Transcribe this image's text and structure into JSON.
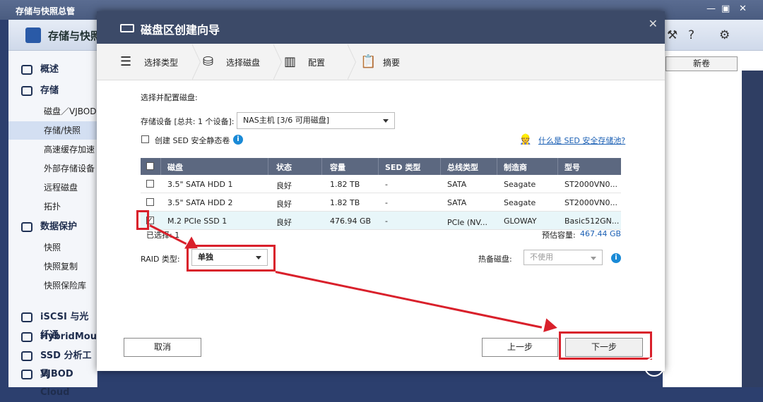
{
  "window": {
    "title": "存储与快照总管"
  },
  "app": {
    "name": "存储与快照"
  },
  "sidebar": {
    "items": [
      {
        "label": "概述",
        "level": 0
      },
      {
        "label": "存储",
        "level": 0
      },
      {
        "label": "磁盘／VJBOD",
        "level": 1
      },
      {
        "label": "存储/快照",
        "level": 1,
        "selected": true
      },
      {
        "label": "高速缓存加速",
        "level": 1
      },
      {
        "label": "外部存储设备",
        "level": 1
      },
      {
        "label": "远程磁盘",
        "level": 1
      },
      {
        "label": "拓扑",
        "level": 1
      },
      {
        "label": "数据保护",
        "level": 0
      },
      {
        "label": "快照",
        "level": 1
      },
      {
        "label": "快照复制",
        "level": 1
      },
      {
        "label": "快照保险库",
        "level": 1
      },
      {
        "label": "iSCSI 与光纤通",
        "level": 0
      },
      {
        "label": "HybridMount",
        "level": 0
      },
      {
        "label": "SSD 分析工具",
        "level": 0
      },
      {
        "label": "VJBOD Cloud",
        "level": 0
      }
    ]
  },
  "main": {
    "new_volume_label": "新卷"
  },
  "dialog": {
    "title": "磁盘区创建向导",
    "steps": [
      "选择类型",
      "选择磁盘",
      "配置",
      "摘要"
    ],
    "section_title": "选择并配置磁盘:",
    "storage_device_label": "存储设备 [总共: 1 个设备]:",
    "storage_device_value": "NAS主机 [3/6 可用磁盘]",
    "sed_checkbox_label": "创建 SED 安全静态卷",
    "sed_link": "什么是 SED 安全存储池?",
    "table": {
      "headers": [
        "磁盘",
        "状态",
        "容量",
        "SED 类型",
        "总线类型",
        "制造商",
        "型号"
      ],
      "rows": [
        {
          "checked": false,
          "disk": "3.5\" SATA HDD 1",
          "status": "良好",
          "capacity": "1.82 TB",
          "sed": "-",
          "bus": "SATA",
          "maker": "Seagate",
          "model": "ST2000VN0..."
        },
        {
          "checked": false,
          "disk": "3.5\" SATA HDD 2",
          "status": "良好",
          "capacity": "1.82 TB",
          "sed": "-",
          "bus": "SATA",
          "maker": "Seagate",
          "model": "ST2000VN0..."
        },
        {
          "checked": true,
          "disk": "M.2 PCIe SSD 1",
          "status": "良好",
          "capacity": "476.94 GB",
          "sed": "-",
          "bus": "PCIe (NV...",
          "maker": "GLOWAY",
          "model": "Basic512GN..."
        }
      ]
    },
    "selected_count": "已选择: 1",
    "estimated_label": "预估容量:",
    "estimated_value": "467.44 GB",
    "raid_label": "RAID 类型:",
    "raid_value": "单独",
    "hot_spare_label": "热备磁盘:",
    "hot_spare_value": "不使用",
    "cancel": "取消",
    "prev": "上一步",
    "next": "下一步"
  },
  "watermark": "什么值得买",
  "colors": {
    "header": "#3c4a68",
    "link": "#1a5fb4",
    "annotation": "#d9202b"
  }
}
